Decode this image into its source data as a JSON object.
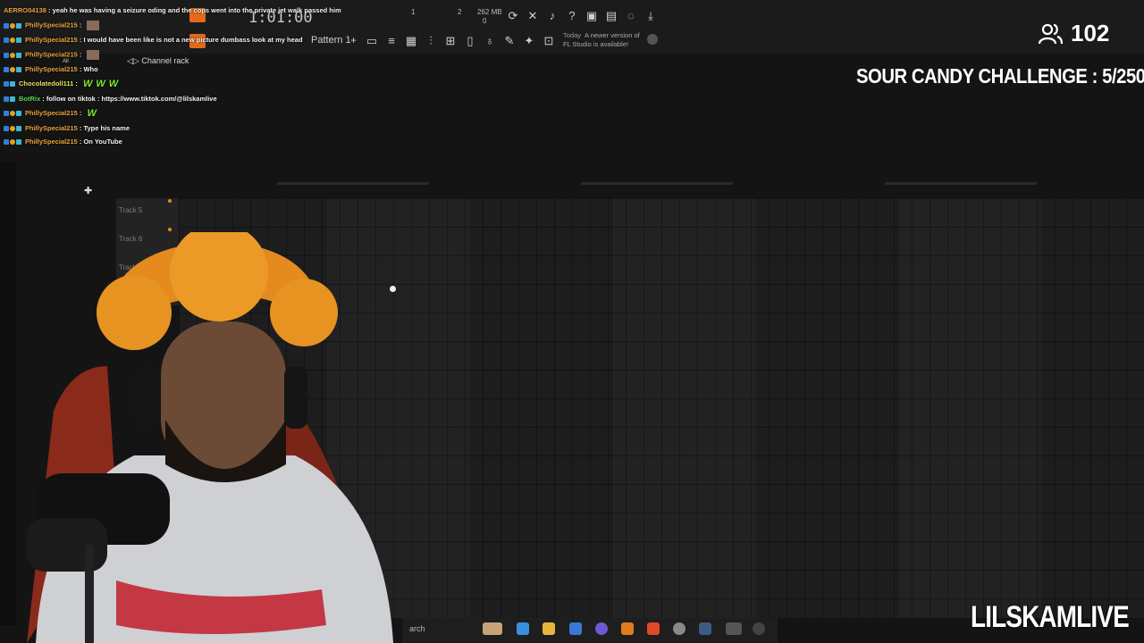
{
  "fl_studio": {
    "time": "1:01:00",
    "beat_a": "1",
    "beat_b": "2",
    "memory": "262 MB",
    "memory_sub": "0",
    "pattern": "Pattern 1",
    "pattern_add": "+",
    "news_label": "Today",
    "news_line1": "A newer version of",
    "news_line2": "FL Studio is available!",
    "channel_rack": "Channel rack",
    "tracks": [
      "Track 5",
      "Track 6",
      "Track"
    ]
  },
  "chat": {
    "messages": [
      {
        "user": "AERRO04138",
        "text": "yeah he was having a seizure oding and the cops went into the private jet walk passed him"
      },
      {
        "user": "PhillySpecial215",
        "text": ""
      },
      {
        "user": "PhillySpecial215",
        "text": "I would have been like is not a new picture dumbass look at my head"
      },
      {
        "user": "PhillySpecial215",
        "text": ""
      },
      {
        "user": "PhillySpecial215",
        "text": "Who"
      },
      {
        "user": "Chocolatedoll111",
        "text": ""
      },
      {
        "user": "BotRix",
        "text": "follow on tiktok : https://www.tiktok.com/@lilskamlive"
      },
      {
        "user": "PhillySpecial215",
        "text": ""
      },
      {
        "user": "PhillySpecial215",
        "text": "Type his name"
      },
      {
        "user": "PhillySpecial215",
        "text": "On YouTube"
      }
    ],
    "emote_w": "W",
    "all_label": "All"
  },
  "stream": {
    "viewer_count": "102",
    "challenge": "SOUR CANDY CHALLENGE : 5/250",
    "brand": "LILSKAMLIVE"
  },
  "taskbar": {
    "search_label": "arch"
  },
  "colors": {
    "accent_orange": "#e46a17",
    "emote_green": "#7bea2c",
    "username_orange": "#e8a23a"
  }
}
